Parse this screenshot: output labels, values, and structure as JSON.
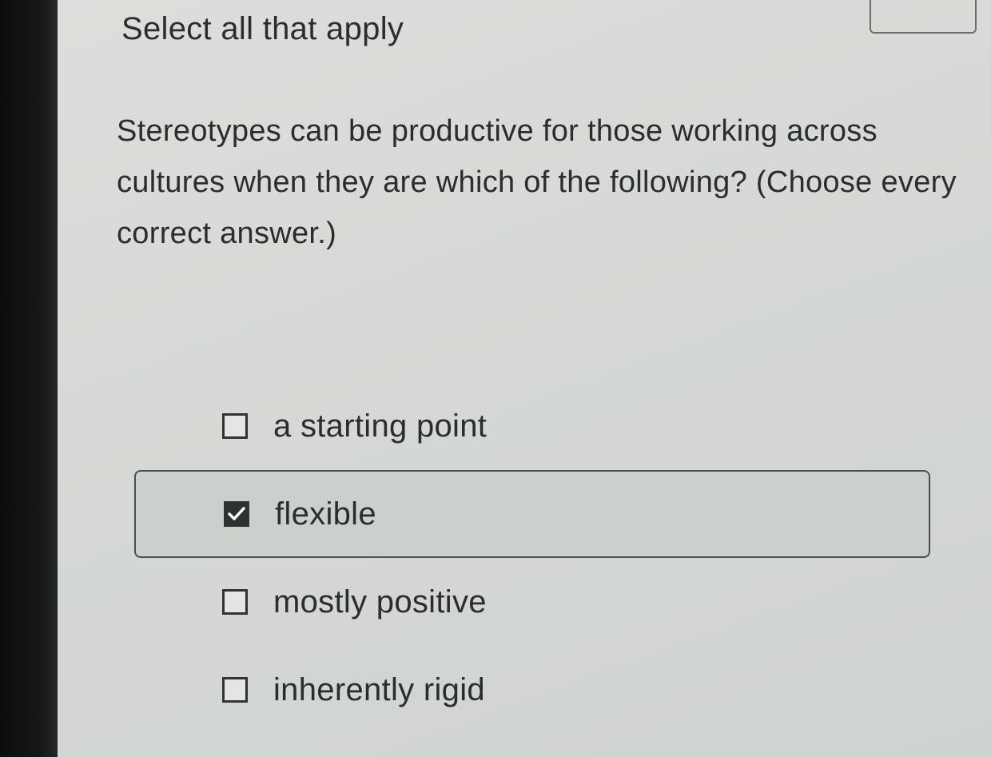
{
  "prompt": {
    "instruction": "Select all that apply",
    "question": "Stereotypes can be productive for those working across cultures when they are which of the following? (Choose every correct answer.)"
  },
  "options": [
    {
      "label": "a starting point",
      "checked": false
    },
    {
      "label": "flexible",
      "checked": true
    },
    {
      "label": "mostly positive",
      "checked": false
    },
    {
      "label": "inherently rigid",
      "checked": false
    }
  ],
  "colors": {
    "screen_background": "#d8dbd7",
    "text": "#2a2d2e",
    "selected_background": "#ccd0cc",
    "checkbox_checked": "#2d3232"
  },
  "icons": {
    "checked": "checkmark-icon"
  }
}
